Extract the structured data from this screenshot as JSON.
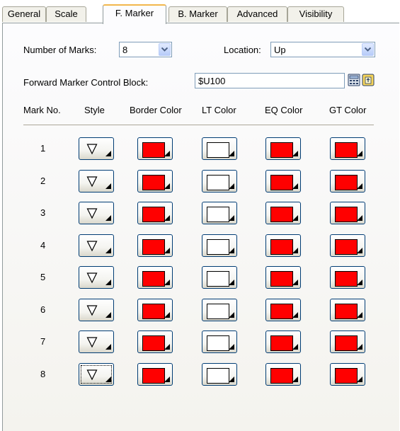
{
  "tabs": [
    {
      "label": "General"
    },
    {
      "label": "Scale"
    },
    {
      "label": "F. Marker",
      "active": true
    },
    {
      "label": "B. Marker"
    },
    {
      "label": "Advanced"
    },
    {
      "label": "Visibility"
    }
  ],
  "form": {
    "number_of_marks_label": "Number of Marks:",
    "number_of_marks_value": "8",
    "location_label": "Location:",
    "location_value": "Up",
    "control_block_label": "Forward Marker Control Block:",
    "control_block_value": "$U100"
  },
  "table": {
    "headers": [
      "Mark No.",
      "Style",
      "Border Color",
      "LT Color",
      "EQ Color",
      "GT Color"
    ],
    "rows": [
      {
        "num": "1",
        "border": "red",
        "lt": "white",
        "eq": "red",
        "gt": "red"
      },
      {
        "num": "2",
        "border": "red",
        "lt": "white",
        "eq": "red",
        "gt": "red"
      },
      {
        "num": "3",
        "border": "red",
        "lt": "white",
        "eq": "red",
        "gt": "red"
      },
      {
        "num": "4",
        "border": "red",
        "lt": "white",
        "eq": "red",
        "gt": "red"
      },
      {
        "num": "5",
        "border": "red",
        "lt": "white",
        "eq": "red",
        "gt": "red"
      },
      {
        "num": "6",
        "border": "red",
        "lt": "white",
        "eq": "red",
        "gt": "red"
      },
      {
        "num": "7",
        "border": "red",
        "lt": "white",
        "eq": "red",
        "gt": "red"
      },
      {
        "num": "8",
        "border": "red",
        "lt": "white",
        "eq": "red",
        "gt": "red"
      }
    ],
    "focused_row": "8"
  },
  "colors": {
    "red": "#ff0000",
    "white": "#ffffff",
    "active_tab_accent": "#f2b74c"
  },
  "icons": {
    "style_symbol": "down-triangle-icon",
    "dropdown_arrow": "chevron-down-icon",
    "calculator": "calculator-icon",
    "tag": "tag-icon"
  }
}
